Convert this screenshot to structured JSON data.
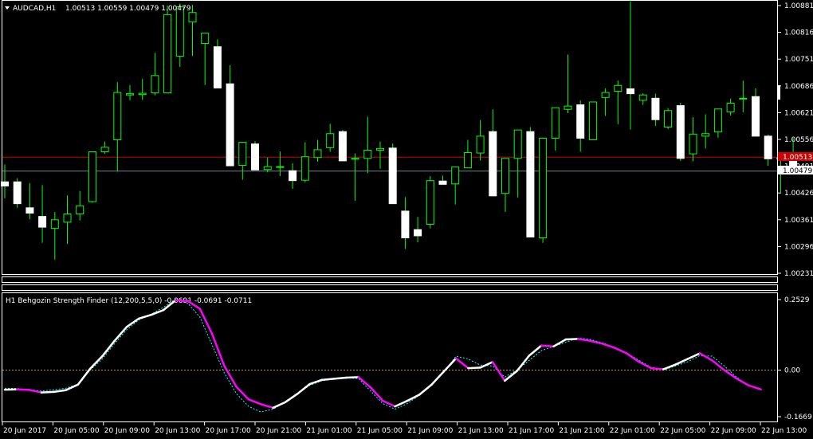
{
  "main_panel": {
    "symbol_timeframe": "AUDCAD,H1",
    "ohlc": "1.00513 1.00559 1.00479 1.00479",
    "bid_price": "1.00513",
    "last_price": "1.00479"
  },
  "indicator_panel": {
    "title": "H1 Behgozin Strength Finder (12,200,5,5,0) -0.0691 -0.0691 -0.0711"
  },
  "colors": {
    "background": "#000000",
    "bull_wick": "#00ff00",
    "bear_body": "#ffffff",
    "bid_line": "#cc0000",
    "ask_line": "#708090",
    "strength_up": "#ffffff",
    "strength_down": "#ff00ff",
    "signal_line": "#00ffff",
    "zero_line": "#c8a000"
  },
  "chart_data": [
    {
      "type": "candlestick",
      "title": "AUDCAD,H1",
      "y_ticks": [
        "1.00881",
        "1.00816",
        "1.00751",
        "1.00686",
        "1.00621",
        "1.00556",
        "1.00491",
        "1.00426",
        "1.00361",
        "1.00296",
        "1.00231"
      ],
      "ylim": [
        1.00231,
        1.00881
      ],
      "x_ticks": [
        "20 Jun 2017",
        "20 Jun 05:00",
        "20 Jun 09:00",
        "20 Jun 13:00",
        "20 Jun 17:00",
        "20 Jun 21:00",
        "21 Jun 01:00",
        "21 Jun 05:00",
        "21 Jun 09:00",
        "21 Jun 13:00",
        "21 Jun 17:00",
        "21 Jun 21:00",
        "22 Jun 01:00",
        "22 Jun 05:00",
        "22 Jun 09:00",
        "22 Jun 13:00"
      ],
      "candles": [
        [
          1.00453,
          1.00495,
          1.00413,
          1.00443
        ],
        [
          1.00453,
          1.00462,
          1.0039,
          1.004
        ],
        [
          1.0039,
          1.0045,
          1.00362,
          1.00377
        ],
        [
          1.00369,
          1.00445,
          1.00305,
          1.00343
        ],
        [
          1.0034,
          1.0038,
          1.00264,
          1.00361
        ],
        [
          1.00355,
          1.0042,
          1.00302,
          1.00375
        ],
        [
          1.00375,
          1.00431,
          1.00359,
          1.00395
        ],
        [
          1.00405,
          1.00526,
          1.00402,
          1.00526
        ],
        [
          1.00526,
          1.00551,
          1.00521,
          1.00537
        ],
        [
          1.00555,
          1.00695,
          1.00478,
          1.0067
        ],
        [
          1.00664,
          1.00688,
          1.00651,
          1.00667
        ],
        [
          1.00665,
          1.00703,
          1.00652,
          1.00668
        ],
        [
          1.00669,
          1.00766,
          1.00663,
          1.00711
        ],
        [
          1.00669,
          1.00881,
          1.00669,
          1.00859
        ],
        [
          1.00758,
          1.00886,
          1.00732,
          1.00878
        ],
        [
          1.00841,
          1.00883,
          1.00759,
          1.00864
        ],
        [
          1.00789,
          1.00813,
          1.00688,
          1.00814
        ],
        [
          1.00781,
          1.00799,
          1.00686,
          1.00681
        ],
        [
          1.00691,
          1.00736,
          1.00492,
          1.00492
        ],
        [
          1.00493,
          1.0055,
          1.00458,
          1.00549
        ],
        [
          1.00545,
          1.00552,
          1.00482,
          1.00482
        ],
        [
          1.00483,
          1.00512,
          1.00476,
          1.0049
        ],
        [
          1.0049,
          1.00527,
          1.00467,
          1.0049
        ],
        [
          1.0048,
          1.00498,
          1.00436,
          1.00456
        ],
        [
          1.00457,
          1.00549,
          1.00452,
          1.00514
        ],
        [
          1.00512,
          1.00555,
          1.00502,
          1.00531
        ],
        [
          1.00536,
          1.00594,
          1.00526,
          1.0057
        ],
        [
          1.00575,
          1.00579,
          1.0051,
          1.00504
        ],
        [
          1.0051,
          1.00522,
          1.00407,
          1.0051
        ],
        [
          1.0051,
          1.00611,
          1.00474,
          1.0053
        ],
        [
          1.0053,
          1.00551,
          1.00485,
          1.00534
        ],
        [
          1.00535,
          1.00546,
          1.00403,
          1.004
        ],
        [
          1.00382,
          1.00416,
          1.0029,
          1.00317
        ],
        [
          1.00337,
          1.00368,
          1.00306,
          1.00322
        ],
        [
          1.0035,
          1.00467,
          1.0034,
          1.00456
        ],
        [
          1.00455,
          1.00468,
          1.00447,
          1.00447
        ],
        [
          1.00448,
          1.00475,
          1.00398,
          1.00489
        ],
        [
          1.00487,
          1.00555,
          1.00491,
          1.00524
        ],
        [
          1.00523,
          1.00603,
          1.00505,
          1.00564
        ],
        [
          1.00575,
          1.00629,
          1.00504,
          1.00419
        ],
        [
          1.00425,
          1.00501,
          1.0038,
          1.0051
        ],
        [
          1.0051,
          1.00561,
          1.00415,
          1.00579
        ],
        [
          1.00575,
          1.00586,
          1.00413,
          1.00319
        ],
        [
          1.00317,
          1.00559,
          1.00305,
          1.00559
        ],
        [
          1.00559,
          1.00624,
          1.00529,
          1.00633
        ],
        [
          1.00629,
          1.00762,
          1.0062,
          1.00637
        ],
        [
          1.0064,
          1.00651,
          1.00526,
          1.00559
        ],
        [
          1.00555,
          1.00634,
          1.00555,
          1.00647
        ],
        [
          1.00658,
          1.0068,
          1.00613,
          1.0067
        ],
        [
          1.00673,
          1.00699,
          1.00593,
          1.00687
        ],
        [
          1.00679,
          1.00892,
          1.0058,
          1.00667
        ],
        [
          1.00651,
          1.00668,
          1.0064,
          1.00664
        ],
        [
          1.00656,
          1.00667,
          1.00589,
          1.00604
        ],
        [
          1.00586,
          1.00632,
          1.00581,
          1.00626
        ],
        [
          1.00638,
          1.00645,
          1.00504,
          1.0051
        ],
        [
          1.00521,
          1.0061,
          1.00503,
          1.00569
        ],
        [
          1.00564,
          1.00617,
          1.00534,
          1.0057
        ],
        [
          1.00574,
          1.00622,
          1.0056,
          1.0063
        ],
        [
          1.00623,
          1.00655,
          1.00614,
          1.00644
        ],
        [
          1.00655,
          1.00699,
          1.00622,
          1.00656
        ],
        [
          1.0066,
          1.0068,
          1.00563,
          1.00564
        ],
        [
          1.00564,
          1.00568,
          1.00492,
          1.00509
        ],
        [
          1.00511,
          1.00525,
          1.00426,
          1.00508
        ],
        [
          1.00513,
          1.00559,
          1.00479,
          1.00479
        ]
      ]
    },
    {
      "type": "line",
      "title": "H1 Behgozin Strength Finder (12,200,5,5,0)",
      "y_ticks": [
        "0.2529",
        "0.00",
        "-0.1669"
      ],
      "ylim": [
        -0.1669,
        0.2529
      ],
      "series": [
        {
          "values": [
            -0.07,
            -0.069,
            -0.071,
            -0.08,
            -0.078,
            -0.072,
            -0.052,
            0.005,
            0.05,
            0.105,
            0.155,
            0.185,
            0.198,
            0.215,
            0.25,
            0.248,
            0.22,
            0.13,
            0.015,
            -0.06,
            -0.105,
            -0.122,
            -0.135,
            -0.115,
            -0.085,
            -0.05,
            -0.035,
            -0.031,
            -0.027,
            -0.025,
            -0.062,
            -0.11,
            -0.13,
            -0.11,
            -0.088,
            -0.052,
            -0.005,
            0.042,
            0.007,
            0.009,
            0.029,
            -0.038,
            -0.003,
            0.052,
            0.088,
            0.085,
            0.11,
            0.112,
            0.105,
            0.095,
            0.08,
            0.06,
            0.03,
            0.007,
            0.003,
            0.02,
            0.04,
            0.06,
            0.035,
            0.0,
            -0.03,
            -0.055,
            -0.069
          ]
        },
        {
          "values": [
            -0.065,
            -0.066,
            -0.07,
            -0.075,
            -0.07,
            -0.065,
            -0.05,
            0.0,
            0.04,
            0.095,
            0.145,
            0.18,
            0.2,
            0.225,
            0.255,
            0.24,
            0.19,
            0.09,
            -0.01,
            -0.085,
            -0.13,
            -0.15,
            -0.14,
            -0.115,
            -0.085,
            -0.055,
            -0.038,
            -0.032,
            -0.028,
            -0.03,
            -0.075,
            -0.12,
            -0.14,
            -0.12,
            -0.09,
            -0.052,
            -0.008,
            0.05,
            0.04,
            0.018,
            0.015,
            -0.025,
            0.0,
            0.035,
            0.07,
            0.085,
            0.1,
            0.115,
            0.11,
            0.098,
            0.082,
            0.062,
            0.035,
            0.01,
            0.0,
            0.015,
            0.03,
            0.052,
            0.05,
            0.015,
            -0.025,
            -0.055,
            -0.0711
          ]
        }
      ]
    }
  ]
}
